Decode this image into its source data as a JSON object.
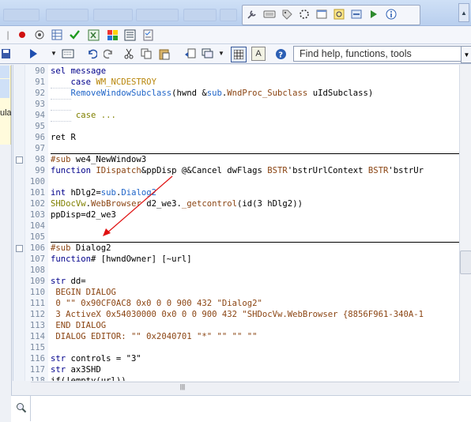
{
  "toolbar_top": {
    "icons": [
      "wrench-icon",
      "keyboard-icon",
      "tag-icon",
      "spinner-icon",
      "window-icon",
      "search-window-icon",
      "dialog-icon",
      "run-icon",
      "info-icon"
    ]
  },
  "toolbar2": {
    "icons": [
      "record-icon",
      "record-stop-icon",
      "table-icon",
      "check-icon",
      "excel-icon",
      "color-icon",
      "list-icon",
      "checklist-icon"
    ]
  },
  "toolbar3": {
    "icons": [
      "save-icon",
      "run-icon",
      "dropdown-icon",
      "tabs-icon",
      "undo-icon",
      "redo-icon",
      "cut-icon",
      "copy-icon",
      "paste-icon",
      "back-icon",
      "windows-icon",
      "grid-icon",
      "text-icon",
      "help-icon"
    ],
    "search_placeholder": "Find help, functions, tools"
  },
  "left_panel": {
    "text": "ula"
  },
  "editor": {
    "lines": [
      {
        "n": "90",
        "segments": [
          {
            "t": "sel message",
            "c": "c-k"
          }
        ]
      },
      {
        "n": "91",
        "segments": [
          {
            "t": "    ",
            "c": "guide"
          },
          {
            "t": "case ",
            "c": "c-k"
          },
          {
            "t": "WM_NCDESTROY",
            "c": "c-dir"
          }
        ]
      },
      {
        "n": "92",
        "segments": [
          {
            "t": "    ",
            "c": "guide"
          },
          {
            "t": "RemoveWindowSubclass",
            "c": "c-blue"
          },
          {
            "t": "(hwnd &",
            "c": ""
          },
          {
            "t": "sub",
            "c": "c-blue"
          },
          {
            "t": ".",
            "c": ""
          },
          {
            "t": "WndProc_Subclass",
            "c": "c-brown"
          },
          {
            "t": " uIdSubclass)",
            "c": ""
          }
        ]
      },
      {
        "n": "93",
        "segments": [
          {
            "t": "    ",
            "c": "guide"
          }
        ]
      },
      {
        "n": "94",
        "segments": [
          {
            "t": "    ",
            "c": "guide"
          },
          {
            "t": " case ...",
            "c": "c-str"
          }
        ]
      },
      {
        "n": "95",
        "segments": []
      },
      {
        "n": "96",
        "segments": [
          {
            "t": "ret R",
            "c": ""
          }
        ]
      },
      {
        "n": "97",
        "segments": []
      },
      {
        "n": "98",
        "segments": [
          {
            "t": "#sub ",
            "c": "c-brown"
          },
          {
            "t": "we4_NewWindow3",
            "c": ""
          }
        ]
      },
      {
        "n": "99",
        "segments": [
          {
            "t": "function ",
            "c": "c-k"
          },
          {
            "t": "IDispatch",
            "c": "c-brown"
          },
          {
            "t": "&ppDisp @&Cancel dwFlags ",
            "c": ""
          },
          {
            "t": "BSTR",
            "c": "c-brown"
          },
          {
            "t": "'bstrUrlContext ",
            "c": ""
          },
          {
            "t": "BSTR",
            "c": "c-brown"
          },
          {
            "t": "'bstrUr",
            "c": ""
          }
        ]
      },
      {
        "n": "100",
        "segments": []
      },
      {
        "n": "101",
        "segments": [
          {
            "t": "int ",
            "c": "c-k"
          },
          {
            "t": "hDlg2=",
            "c": ""
          },
          {
            "t": "sub",
            "c": "c-blue"
          },
          {
            "t": ".",
            "c": ""
          },
          {
            "t": "Dialog2",
            "c": "c-blue"
          }
        ]
      },
      {
        "n": "102",
        "segments": [
          {
            "t": "SHDocVw",
            "c": "c-str"
          },
          {
            "t": ".",
            "c": ""
          },
          {
            "t": "WebBrowser",
            "c": "c-brown"
          },
          {
            "t": " d2_we3.",
            "c": ""
          },
          {
            "t": "_getcontrol",
            "c": "c-brown"
          },
          {
            "t": "(id(3 hDlg2))",
            "c": ""
          }
        ]
      },
      {
        "n": "103",
        "segments": [
          {
            "t": "ppDisp=d2_we3",
            "c": ""
          }
        ]
      },
      {
        "n": "104",
        "segments": []
      },
      {
        "n": "105",
        "segments": []
      },
      {
        "n": "106",
        "segments": [
          {
            "t": "#sub ",
            "c": "c-brown"
          },
          {
            "t": "Dialog2",
            "c": ""
          }
        ]
      },
      {
        "n": "107",
        "segments": [
          {
            "t": "function",
            "c": "c-k"
          },
          {
            "t": "# [hwndOwner] [~url]",
            "c": ""
          }
        ]
      },
      {
        "n": "108",
        "segments": []
      },
      {
        "n": "109",
        "segments": [
          {
            "t": "str ",
            "c": "c-k"
          },
          {
            "t": "dd=",
            "c": ""
          }
        ]
      },
      {
        "n": "110",
        "segments": [
          {
            "t": " BEGIN DIALOG",
            "c": "c-brown"
          }
        ]
      },
      {
        "n": "111",
        "segments": [
          {
            "t": " 0 \"\" 0x90CF0AC8 0x0 0 0 900 432 \"Dialog2\"",
            "c": "c-brown"
          }
        ]
      },
      {
        "n": "112",
        "segments": [
          {
            "t": " 3 ActiveX 0x54030000 0x0 0 0 900 432 \"SHDocVw.WebBrowser {8856F961-340A-1",
            "c": "c-brown"
          }
        ]
      },
      {
        "n": "113",
        "segments": [
          {
            "t": " END DIALOG",
            "c": "c-brown"
          }
        ]
      },
      {
        "n": "114",
        "segments": [
          {
            "t": " DIALOG EDITOR: \"\" 0x2040701 \"*\" \"\" \"\" \"\"",
            "c": "c-brown"
          }
        ]
      },
      {
        "n": "115",
        "segments": []
      },
      {
        "n": "116",
        "segments": [
          {
            "t": "str ",
            "c": "c-k"
          },
          {
            "t": "controls = \"3\"",
            "c": ""
          }
        ]
      },
      {
        "n": "117",
        "segments": [
          {
            "t": "str ",
            "c": "c-k"
          },
          {
            "t": "ax3SHD",
            "c": ""
          }
        ]
      },
      {
        "n": "118",
        "segments": [
          {
            "t": "if(!empty(url))",
            "c": ""
          }
        ]
      }
    ]
  },
  "hscroll": {
    "grip": "|||"
  },
  "bottom": {
    "find_icon": "magnifier-icon"
  }
}
